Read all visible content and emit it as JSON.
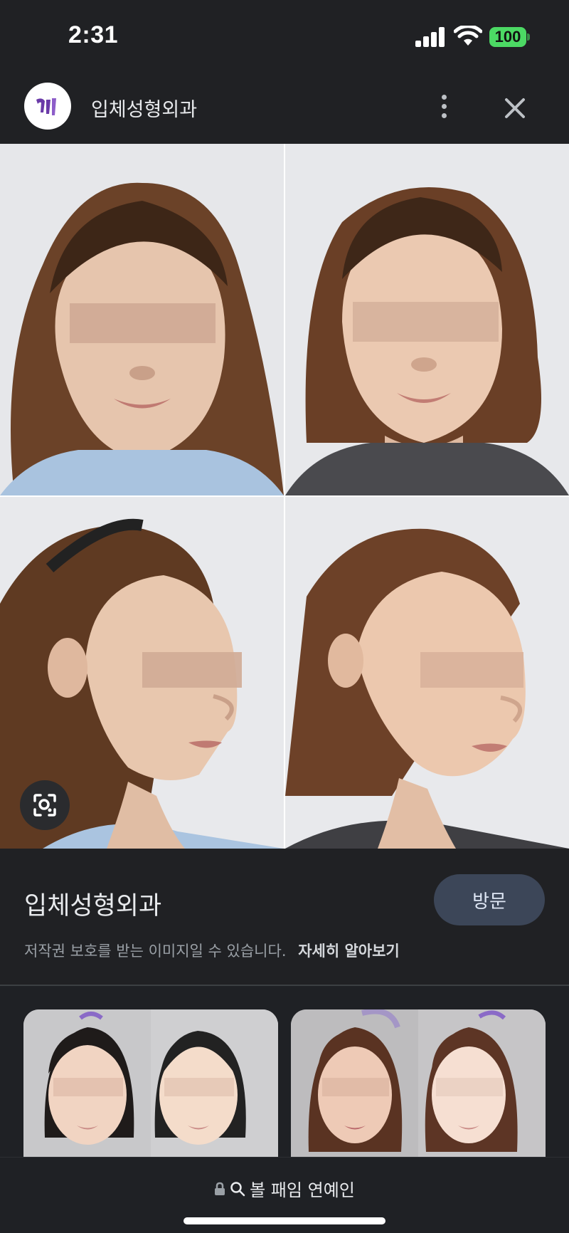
{
  "status_bar": {
    "time": "2:31",
    "battery": "100"
  },
  "header": {
    "title": "입체성형외과",
    "logo_icon": "clinic-logo-icon"
  },
  "image": {
    "description_icon": "lens-icon"
  },
  "info": {
    "title": "입체성형외과",
    "visit_label": "방문",
    "copyright_text": "저작권 보호를 받는 이미지일 수 있습니다.",
    "learn_more": "자세히 알아보기"
  },
  "bottom": {
    "query": "볼 패임 연예인"
  },
  "colors": {
    "accent_button": "#3c4658",
    "battery": "#4cd964",
    "background": "#202124"
  }
}
